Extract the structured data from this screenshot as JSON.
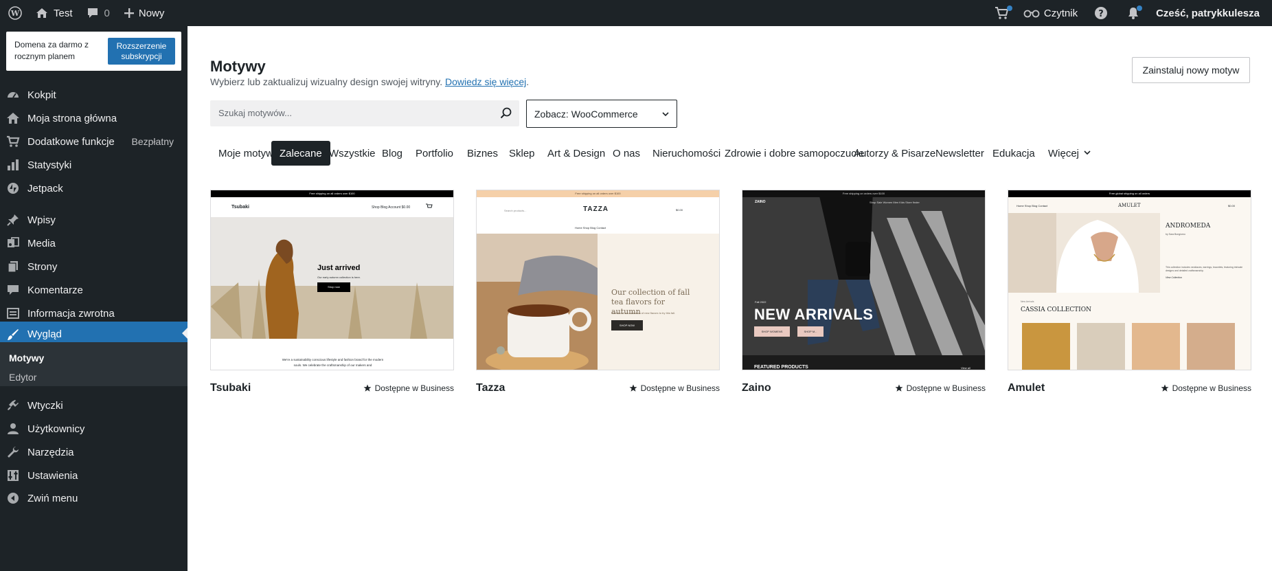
{
  "adminbar": {
    "site_name": "Test",
    "comments_count": "0",
    "new_label": "Nowy",
    "reader_label": "Czytnik",
    "greeting": "Cześć, patrykkulesza"
  },
  "sidebar": {
    "promo": {
      "text": "Domena za darmo z rocznym planem",
      "button": "Rozszerzenie subskrypcji"
    },
    "items": [
      {
        "label": "Kokpit",
        "icon": "dashboard-icon"
      },
      {
        "label": "Moja strona główna",
        "icon": "home-icon"
      },
      {
        "label": "Dodatkowe funkcje",
        "icon": "cart-icon",
        "extra": "Bezpłatny"
      },
      {
        "label": "Statystyki",
        "icon": "bar-chart-icon"
      },
      {
        "label": "Jetpack",
        "icon": "jetpack-icon"
      },
      {
        "label": "Wpisy",
        "icon": "pin-icon"
      },
      {
        "label": "Media",
        "icon": "media-icon"
      },
      {
        "label": "Strony",
        "icon": "pages-icon"
      },
      {
        "label": "Komentarze",
        "icon": "comment-icon"
      },
      {
        "label": "Informacja zwrotna",
        "icon": "feedback-icon"
      },
      {
        "label": "Wygląd",
        "icon": "brush-icon"
      },
      {
        "label": "Wtyczki",
        "icon": "plugin-icon"
      },
      {
        "label": "Użytkownicy",
        "icon": "users-icon"
      },
      {
        "label": "Narzędzia",
        "icon": "wrench-icon"
      },
      {
        "label": "Ustawienia",
        "icon": "settings-icon"
      },
      {
        "label": "Zwiń menu",
        "icon": "collapse-icon"
      }
    ],
    "submenu": {
      "current": "Motywy",
      "other": "Edytor"
    }
  },
  "main": {
    "title": "Motywy",
    "subtitle": "Wybierz lub zaktualizuj wizualny design swojej witryny.",
    "subtitle_link": "Dowiedz się więcej",
    "install_button": "Zainstaluj nowy motyw",
    "search_placeholder": "Szukaj motywów...",
    "filter_label": "Zobacz: WooCommerce",
    "tabs": [
      "Moje motywy",
      "Zalecane",
      "Wszystkie",
      "Blog",
      "Portfolio",
      "Biznes",
      "Sklep",
      "Art & Design",
      "O nas",
      "Nieruchomości",
      "Zdrowie i dobre samopoczucie",
      "Autorzy & Pisarze",
      "Newsletter",
      "Edukacja",
      "Więcej"
    ],
    "selected_tab": "Zalecane",
    "themes": [
      {
        "name": "Tsubaki",
        "badge": "Dostępne w Business",
        "preview": {
          "topbar": "Free shipping on all orders over $100",
          "logo": "Tsubaki",
          "nav": "Shop   Blog   Account   $0.00",
          "headline": "Just arrived",
          "sub": "Our early autumn collection is here.",
          "cta": "Shop now",
          "footer": "We're a sustainability conscious lifestyle and fashion brand for the modern souls. We celebrate the craftsmanship of our makers and"
        }
      },
      {
        "name": "Tazza",
        "badge": "Dostępne w Business",
        "preview": {
          "topbar": "Free shipping on all orders over $100",
          "logo": "TAZZA",
          "search": "Search products...",
          "cart": "$0.00",
          "nav": "Home   Shop   Blog   Contact",
          "headline": "Our collection of fall tea flavors for autumn",
          "sub": "Check out our collection of new flavors to try this fall.",
          "cta": "SHOP NOW"
        }
      },
      {
        "name": "Zaino",
        "badge": "Dostępne w Business",
        "preview": {
          "topbar": "Free shipping on orders over $100",
          "logo": "ZAINO",
          "nav": "Shop   Sale   Women   Men   Kids   Store finder",
          "kicker": "Fall 2022",
          "headline": "NEW ARRIVALS",
          "cta1": "SHOP WOMENS",
          "cta2": "SHOP M...",
          "footer": "FEATURED PRODUCTS",
          "footer_link": "View all"
        }
      },
      {
        "name": "Amulet",
        "badge": "Dostępne w Business",
        "preview": {
          "topbar": "Free global shipping on all orders",
          "logo": "AMULET",
          "nav": "Home   Shop   Blog   Contact",
          "cart": "$0.00",
          "headline": "ANDROMEDA",
          "byline": "by Sara Bongiorno",
          "blurb": "This collection includes necklaces, earrings, bracelets, featuring intricate designs and detailed craftsmanship.",
          "link": "View Collection",
          "kicker": "New Arrivals",
          "collection": "CASSIA COLLECTION"
        }
      }
    ]
  },
  "colors": {
    "adminbar_bg": "#1d2327",
    "accent": "#2271b1",
    "tab_selected_bg": "#1d2327"
  }
}
